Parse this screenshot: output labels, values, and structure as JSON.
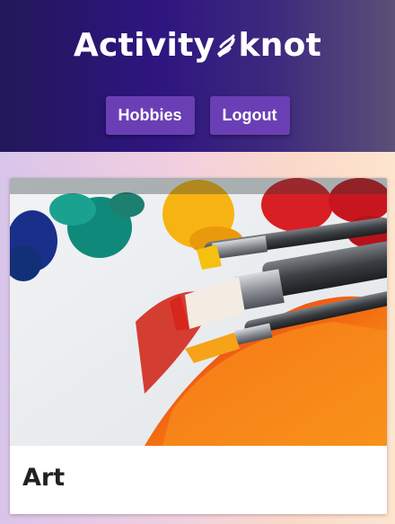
{
  "app": {
    "brand_left": "Activity",
    "brand_right": "knot",
    "logo_icon": "knot-icon"
  },
  "nav": {
    "hobbies_label": "Hobbies",
    "logout_label": "Logout"
  },
  "cards": [
    {
      "title": "Art",
      "image": "paint-brushes-and-paint-tubes"
    }
  ],
  "colors": {
    "header_start": "#22185a",
    "header_end": "#5b5076",
    "button": "#6a3fb5"
  }
}
